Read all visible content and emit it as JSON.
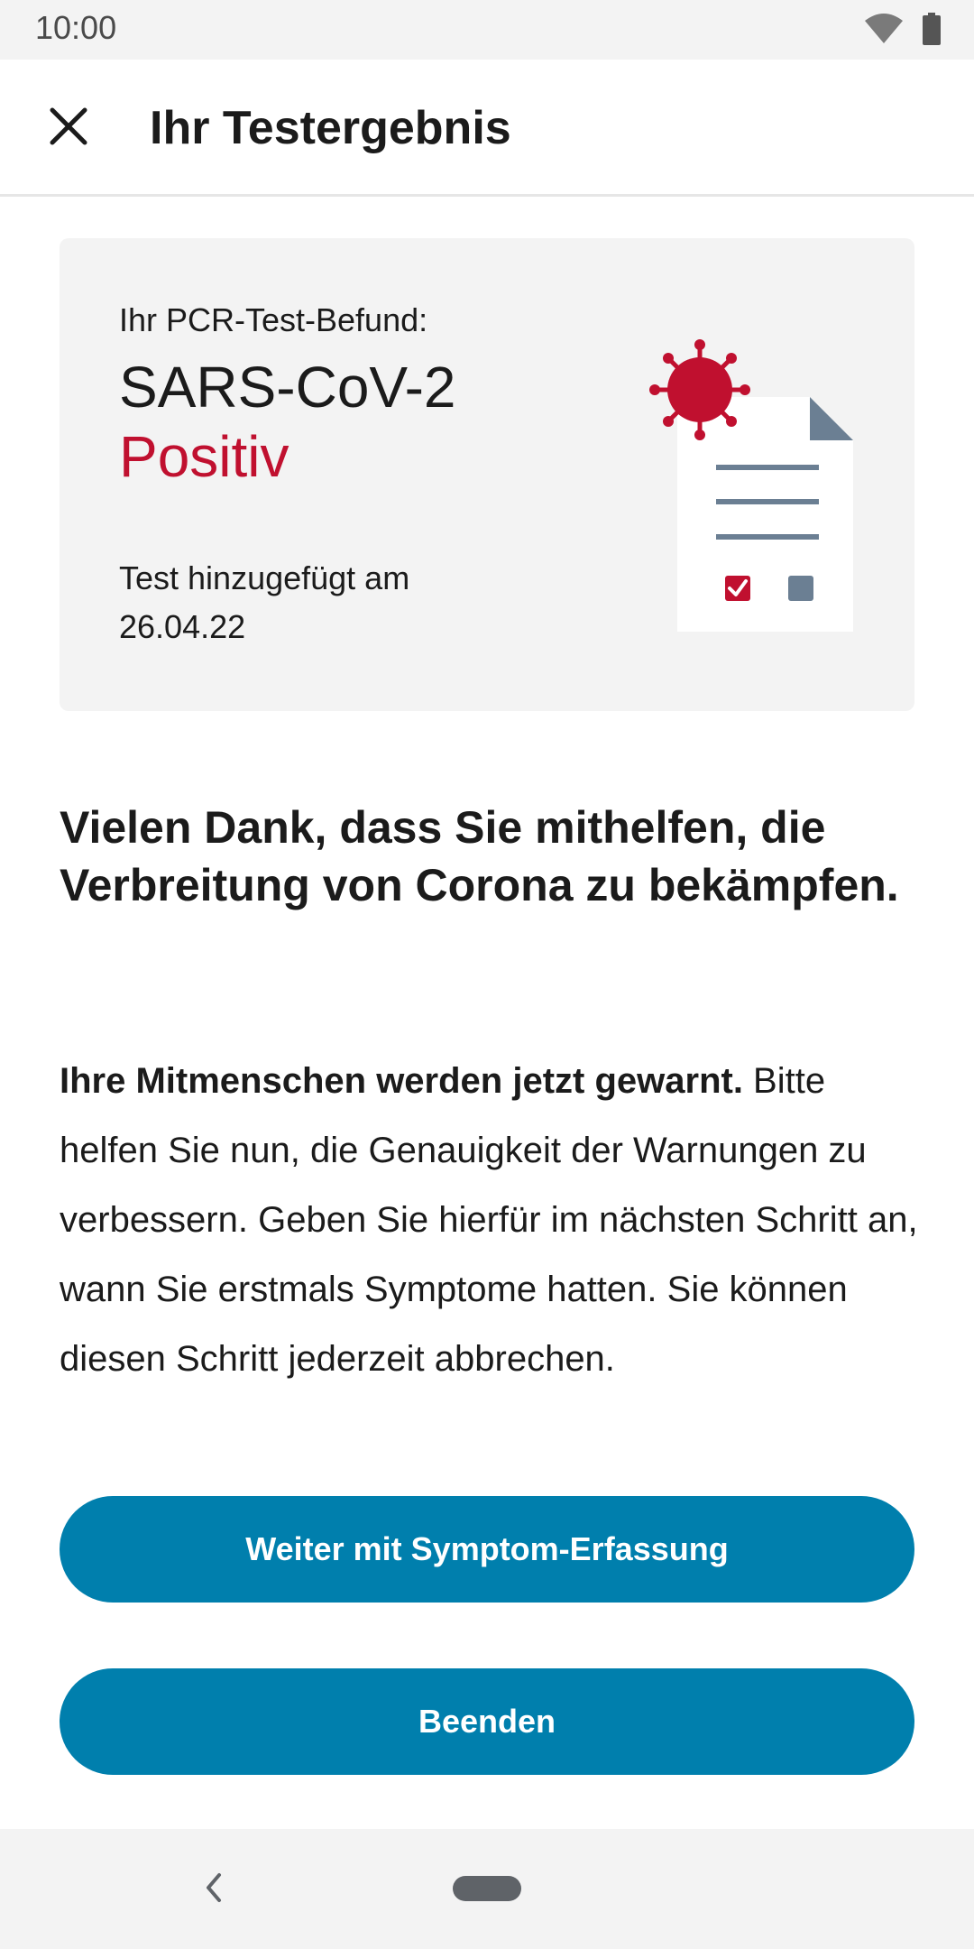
{
  "status_bar": {
    "time": "10:00",
    "icons": [
      "wifi-icon",
      "battery-icon"
    ]
  },
  "app_bar": {
    "close_icon": "close-icon",
    "title": "Ihr Testergebnis"
  },
  "result_card": {
    "label": "Ihr PCR-Test-Befund:",
    "virus": "SARS-CoV-2",
    "result": "Positiv",
    "date_label": "Test hinzugefügt am",
    "date": "26.04.22",
    "illustration_icon": "virus-document-illustration"
  },
  "main": {
    "heading": "Vielen Dank, dass Sie mithelfen, die Verbreitung von Corona zu bekämpfen.",
    "body_bold": "Ihre Mitmenschen werden jetzt gewarnt.",
    "body_rest": " Bitte helfen Sie nun, die Genauigkeit der Warnungen zu verbessern. Geben Sie hierfür im nächsten Schritt an, wann Sie erstmals Symptome hatten. Sie können diesen Schritt jederzeit abbrechen."
  },
  "buttons": {
    "continue_label": "Weiter mit Symptom-Erfassung",
    "finish_label": "Beenden"
  },
  "nav_bar": {
    "back_icon": "back-icon",
    "home_icon": "home-pill"
  },
  "colors": {
    "accent": "#007fad",
    "positive_red": "#c0102f",
    "card_bg": "#f3f3f3",
    "doc_grey": "#6b7f93"
  }
}
